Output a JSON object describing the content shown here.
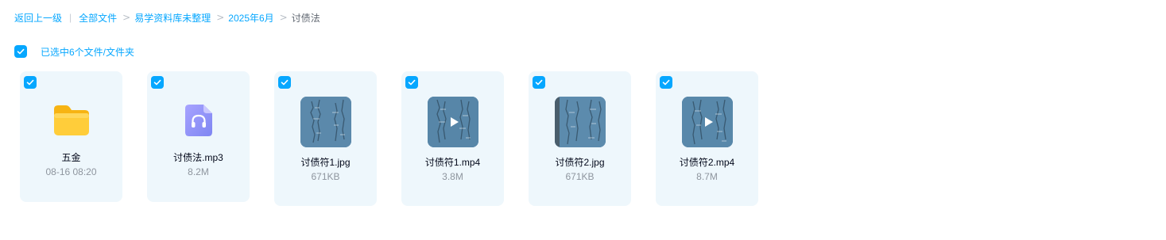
{
  "breadcrumb": {
    "back": "返回上一级",
    "separator": "|",
    "chevron": ">",
    "items": [
      "全部文件",
      "易学资料库未整理",
      "2025年6月"
    ],
    "current": "讨债法"
  },
  "selection": {
    "label": "已选中6个文件/文件夹",
    "checked": true
  },
  "files": [
    {
      "name": "五金",
      "meta": "08-16 08:20",
      "type": "folder",
      "icon": "folder-icon",
      "checked": true
    },
    {
      "name": "讨债法.mp3",
      "meta": "8.2M",
      "type": "audio",
      "icon": "headphones-icon",
      "checked": true
    },
    {
      "name": "讨债符1.jpg",
      "meta": "671KB",
      "type": "image",
      "icon": "image-thumbnail",
      "checked": true
    },
    {
      "name": "讨债符1.mp4",
      "meta": "3.8M",
      "type": "video",
      "icon": "play-icon",
      "checked": true
    },
    {
      "name": "讨债符2.jpg",
      "meta": "671KB",
      "type": "image",
      "icon": "image-thumbnail",
      "checked": true
    },
    {
      "name": "讨债符2.mp4",
      "meta": "8.7M",
      "type": "video",
      "icon": "play-icon",
      "checked": true
    }
  ],
  "colors": {
    "accent": "#06a7ff",
    "card_background": "#eef7fc",
    "folder": "#ffc72c",
    "audio": "#8c8cf7",
    "photo": "#5a87a9"
  }
}
